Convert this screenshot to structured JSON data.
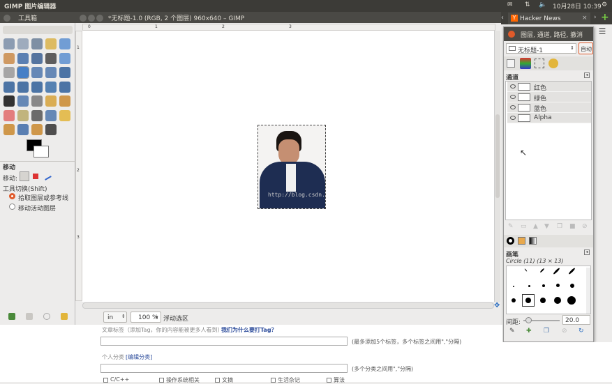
{
  "topbar": {
    "app_title": "GIMP 图片编辑器",
    "datetime": "10月28日 10:39"
  },
  "toolbox": {
    "title": "工具箱",
    "tool_options_title": "移动",
    "move_label": "移动:",
    "tool_toggle_label": "工具切换(Shift)",
    "radio1": "拾取图层或参考线",
    "radio2": "移动活动图层"
  },
  "canvas_window": {
    "title": "*无标题-1.0 (RGB, 2 个图层) 960x640 – GIMP",
    "unit": "in",
    "zoom": "100 %",
    "status": "浮动选区",
    "watermark": "http://blog.csdn.net/"
  },
  "browser": {
    "tab_label": "Hacker News",
    "tab_icon": "Y"
  },
  "docks": {
    "title": "图层, 通道, 路径, 撤消",
    "image_select": "无标题-1",
    "auto_button": "自动",
    "channels_heading": "通道",
    "channels": [
      {
        "name": "红色"
      },
      {
        "name": "绿色"
      },
      {
        "name": "蓝色"
      },
      {
        "name": "Alpha"
      }
    ],
    "brushes_heading": "画笔",
    "brush_name": "Circle (11) (13 × 13)",
    "spacing_label": "间距:",
    "spacing_value": "20.0"
  },
  "webpage": {
    "tag_label": "文章标签（添加Tag，你的内容能被更多人看到）",
    "tag_link": "我们为什么要打Tag？",
    "tag_hint": "(最多添加5个标签，多个标签之间用\",\"分隔)",
    "category_label": "个人分类",
    "category_link": "[编辑分类]",
    "category_hint": "(多个分类之间用\",\"分隔)",
    "checkboxes": [
      "C/C++",
      "操作系统相关",
      "文摘",
      "生活杂记",
      "算法"
    ]
  },
  "ruler_marks": [
    "0",
    "1",
    "2",
    "3"
  ]
}
